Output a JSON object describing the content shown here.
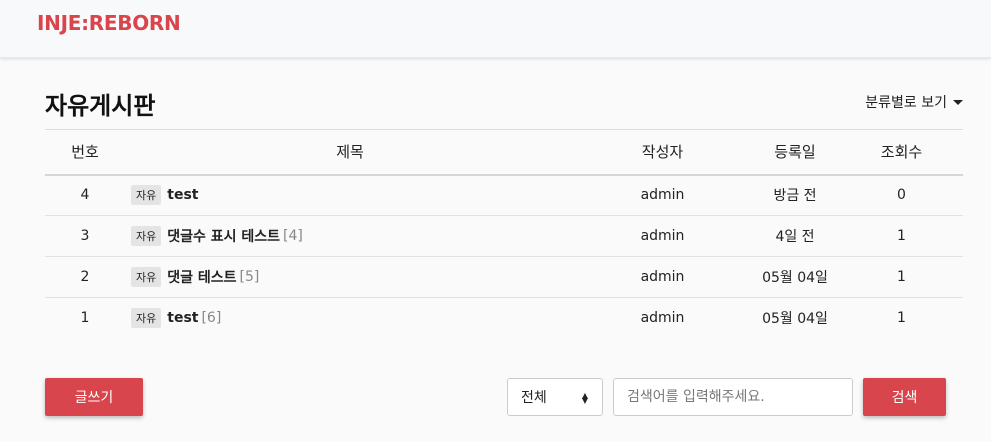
{
  "navbar": {
    "brand": "INJE:REBORN"
  },
  "board": {
    "title": "자유게시판",
    "category_dropdown": "분류별로 보기",
    "columns": [
      "번호",
      "제목",
      "작성자",
      "등록일",
      "조회수"
    ],
    "rows": [
      {
        "num": "4",
        "tag": "자유",
        "title": "test",
        "comments": "",
        "author": "admin",
        "date": "방금 전",
        "views": "0"
      },
      {
        "num": "3",
        "tag": "자유",
        "title": "댓글수 표시 테스트",
        "comments": "[4]",
        "author": "admin",
        "date": "4일 전",
        "views": "1"
      },
      {
        "num": "2",
        "tag": "자유",
        "title": "댓글 테스트",
        "comments": "[5]",
        "author": "admin",
        "date": "05월 04일",
        "views": "1"
      },
      {
        "num": "1",
        "tag": "자유",
        "title": "test",
        "comments": "[6]",
        "author": "admin",
        "date": "05월 04일",
        "views": "1"
      }
    ]
  },
  "actions": {
    "write_label": "글쓰기",
    "search_scope": "전체",
    "search_placeholder": "검색어를 입력해주세요.",
    "search_value": "",
    "search_label": "검색"
  },
  "colors": {
    "accent": "#d9454c",
    "tag_bg": "#e4e4e4"
  }
}
